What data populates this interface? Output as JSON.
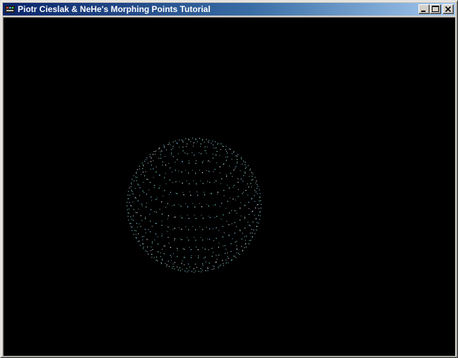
{
  "window": {
    "title": "Piotr Cieslak & NeHe's Morphing Points Tutorial",
    "buttons": {
      "minimize": "minimize-icon",
      "maximize": "maximize-icon",
      "close": "close-icon"
    }
  },
  "scene": {
    "background": "#000000",
    "shape": "sphere",
    "point_colors": [
      "#8fd6ff",
      "#7fe0c8",
      "#a0f0e0",
      "#ffffff"
    ]
  }
}
